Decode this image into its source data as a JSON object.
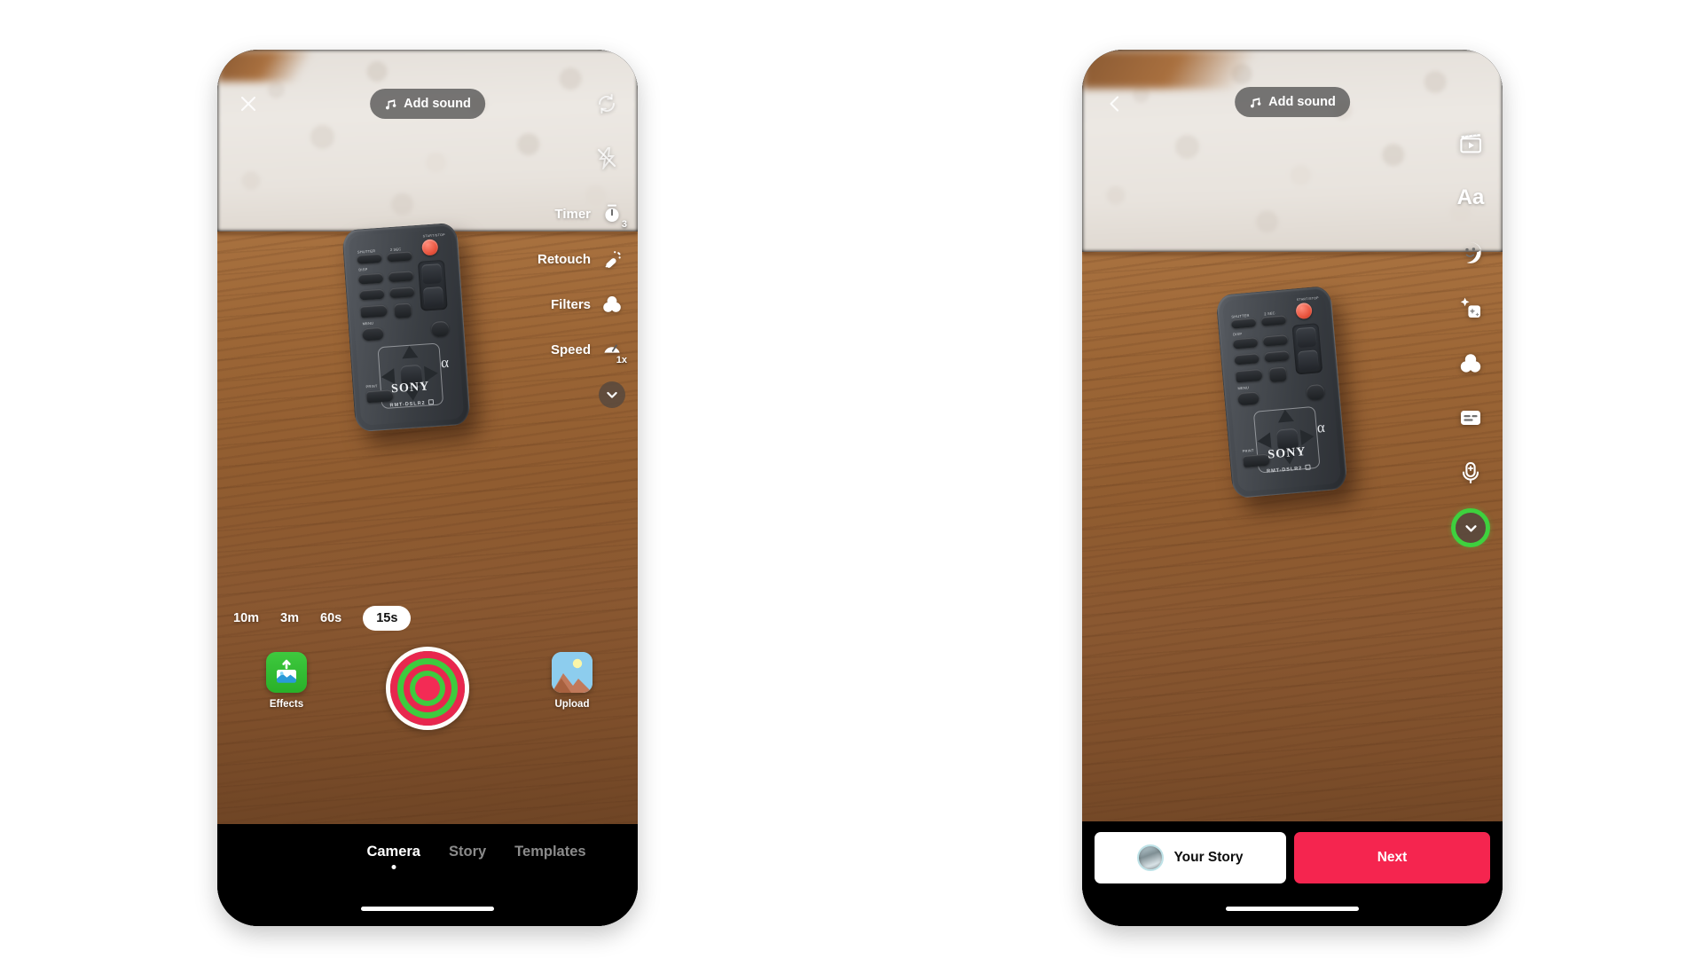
{
  "app": {
    "accent_red": "#F5254F",
    "accent_green": "#3ED13E"
  },
  "left_phone": {
    "close_icon_name": "close-icon",
    "sound_pill": {
      "label": "Add sound",
      "icon": "music-note-icon"
    },
    "top_right_icons": [
      {
        "name": "flip-camera-icon",
        "label": "Flip camera"
      },
      {
        "name": "flash-off-icon",
        "label": "Flash off"
      }
    ],
    "tool_rail": [
      {
        "label": "Timer",
        "icon": "timer-icon",
        "badge": "3"
      },
      {
        "label": "Retouch",
        "icon": "wand-icon",
        "badge": ""
      },
      {
        "label": "Filters",
        "icon": "filters-icon",
        "badge": ""
      },
      {
        "label": "Speed",
        "icon": "speed-icon",
        "badge": "1x"
      }
    ],
    "collapse_icon": "chevron-down-icon",
    "durations": [
      {
        "label": "10m",
        "selected": false
      },
      {
        "label": "3m",
        "selected": false
      },
      {
        "label": "60s",
        "selected": false
      },
      {
        "label": "15s",
        "selected": true
      }
    ],
    "effects": {
      "label": "Effects",
      "icon": "effects-image-icon"
    },
    "upload": {
      "label": "Upload",
      "icon": "photo-thumbnail-icon"
    },
    "record_button": {
      "name": "record-button",
      "ring_colors": [
        "#FFFFFF",
        "#E8274E",
        "#3ECB3E",
        "#E8274E",
        "#3ECB3E",
        "#F32B55"
      ]
    },
    "tabs": [
      {
        "label": "Camera",
        "active": true
      },
      {
        "label": "Story",
        "active": false
      },
      {
        "label": "Templates",
        "active": false
      }
    ],
    "remote": {
      "brand": "SONY",
      "model": "RMT-DSLR2",
      "top_label": "START/STOP",
      "buttons": [
        "SHUTTER",
        "2 SEC",
        "DISP",
        "MENU",
        "PRINT"
      ],
      "alpha_mark": "α"
    }
  },
  "right_phone": {
    "back_icon_name": "back-chevron-icon",
    "sound_pill": {
      "label": "Add sound",
      "icon": "music-note-icon"
    },
    "icon_rail": [
      {
        "name": "clapperboard-icon",
        "label": "Clips"
      },
      {
        "name": "text-aa-icon",
        "label": "Text"
      },
      {
        "name": "sticker-icon",
        "label": "Stickers"
      },
      {
        "name": "effects-sparkle-icon",
        "label": "Effects"
      },
      {
        "name": "filters-icon",
        "label": "Filters"
      },
      {
        "name": "captions-icon",
        "label": "Captions"
      },
      {
        "name": "voice-effects-icon",
        "label": "Voice effects"
      },
      {
        "name": "chevron-down-icon",
        "label": "Collapse"
      }
    ],
    "your_story": {
      "label": "Your Story",
      "avatar": "user-avatar"
    },
    "next": {
      "label": "Next"
    },
    "remote": {
      "brand": "SONY",
      "model": "RMT-DSLR2",
      "top_label": "START/STOP",
      "buttons": [
        "SHUTTER",
        "2 SEC",
        "DISP",
        "MENU",
        "PRINT"
      ],
      "alpha_mark": "α"
    }
  }
}
